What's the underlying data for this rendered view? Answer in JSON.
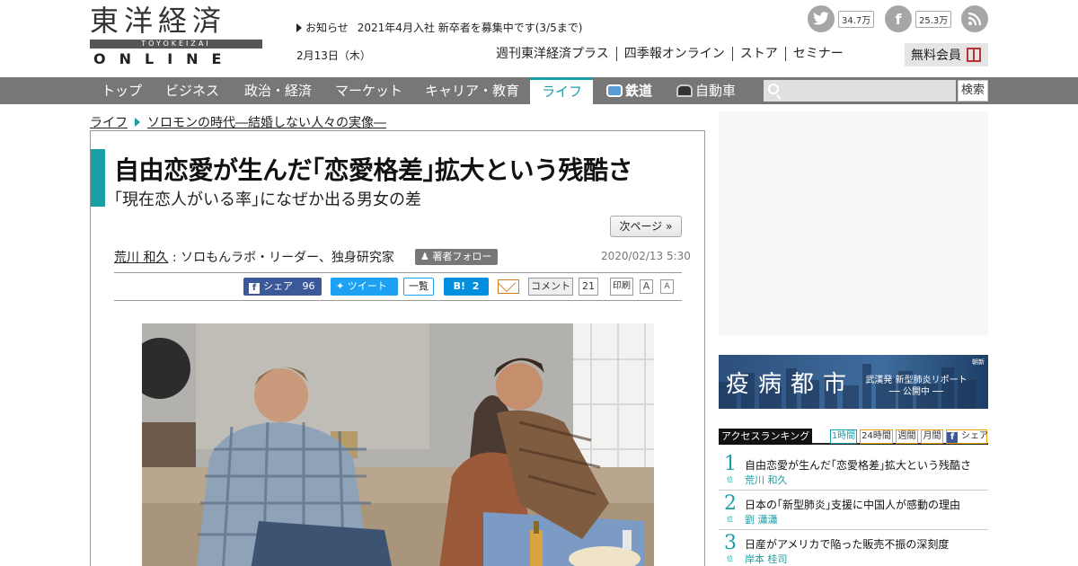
{
  "logo": {
    "kanji": "東洋経済",
    "romaji": "TOYOKEIZAI",
    "online": "ONLINE"
  },
  "notice": {
    "label": "お知らせ",
    "text": "2021年4月入社 新卒者を募集中です(3/5まで)"
  },
  "date": "2月13日（木）",
  "social": {
    "twitter_count": "34.7万",
    "facebook_count": "25.3万"
  },
  "subnav": [
    "週刊東洋経済プラス",
    "四季報オンライン",
    "ストア",
    "セミナー"
  ],
  "member_label": "無料会員",
  "mainnav": [
    "トップ",
    "ビジネス",
    "政治・経済",
    "マーケット",
    "キャリア・教育",
    "ライフ",
    "鉄道",
    "自動車"
  ],
  "search": {
    "placeholder": "",
    "button": "検索"
  },
  "breadcrumb": [
    "ライフ",
    "ソロモンの時代―結婚しない人々の実像―"
  ],
  "article": {
    "title": "自由恋愛が生んだ｢恋愛格差｣拡大という残酷さ",
    "subtitle": "｢現在恋人がいる率｣になぜか出る男女の差",
    "next_page": "次ページ »",
    "author_name": "荒川 和久",
    "author_role": ": ソロもんラボ・リーダー、独身研究家",
    "follow": "著者フォロー",
    "pubdate": "2020/02/13 5:30"
  },
  "share": {
    "fb_label": "シェア",
    "fb_count": "96",
    "tw_label": "ツイート",
    "ichiran": "一覧",
    "hatena_label": "B!",
    "hatena_count": "2",
    "comment_label": "コメント",
    "comment_count": "21",
    "print": "印刷",
    "font_a": "A"
  },
  "banner": {
    "title": "疫病都市",
    "line1": "武漢発 新型肺炎リポート",
    "line2": "── 公開中 ──",
    "tag": "朝新"
  },
  "ranking": {
    "title": "アクセスランキング",
    "tabs": [
      "1時間",
      "24時間",
      "週間",
      "月間",
      "シェア"
    ],
    "items": [
      {
        "num": "1",
        "title": "自由恋愛が生んだ｢恋愛格差｣拡大という残酷さ",
        "author": "荒川 和久"
      },
      {
        "num": "2",
        "title": "日本の｢新型肺炎｣支援に中国人が感動の理由",
        "author": "劉 瀟瀟"
      },
      {
        "num": "3",
        "title": "日産がアメリカで陥った販売不振の深刻度",
        "author": "岸本 桂司"
      }
    ],
    "rank_suffix": "位"
  },
  "colors": {
    "accent": "#1a9ea5",
    "nav_bg": "#777777",
    "fb": "#3b5998",
    "tw": "#1da1f2",
    "hatena": "#008fde"
  }
}
